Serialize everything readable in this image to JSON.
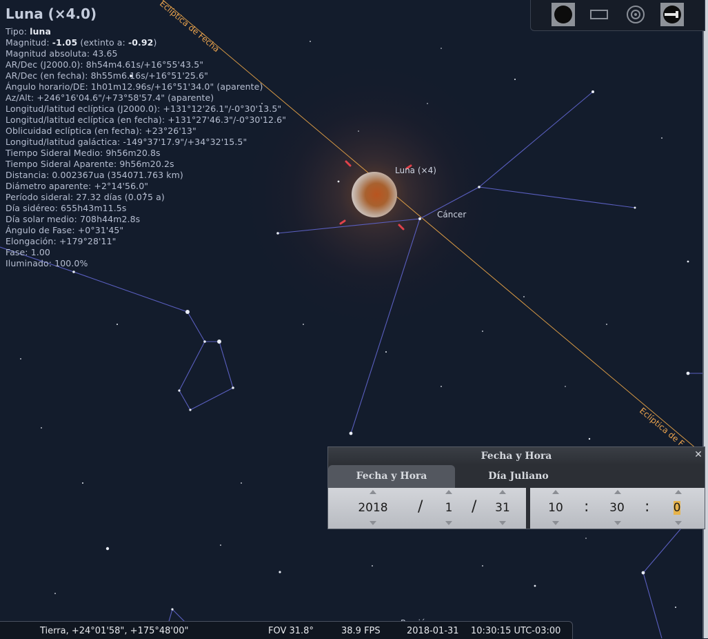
{
  "info": {
    "title": "Luna (×4.0)",
    "tipo_label": "Tipo: ",
    "tipo_value": "luna",
    "magnitud_label": "Magnitud: ",
    "magnitud_value": "-1.05",
    "magnitud_mid": " (extinto a: ",
    "magnitud_ext": "-0.92",
    "magnitud_end": ")",
    "rows": [
      "Magnitud absoluta: 43.65",
      "AR/Dec (J2000.0): 8h54m4.61s/+16°55'43.5\"",
      "AR/Dec (en fecha): 8h55m6.16s/+16°51'25.6\"",
      "Ángulo horario/DE: 1h01m12.96s/+16°51'34.0\" (aparente)",
      "Az/Alt: +246°16'04.6\"/+73°58'57.4\" (aparente)",
      "Longitud/latitud eclíptica (J2000.0): +131°12'26.1\"/-0°30'13.5\"",
      "Longitud/latitud eclíptica (en fecha): +131°27'46.3\"/-0°30'12.6\"",
      "Oblicuidad eclíptica (en fecha): +23°26'13\"",
      "Longitud/latitud galáctica: -149°37'17.9\"/+34°32'15.5\"",
      "Tiempo Sideral Medio: 9h56m20.8s",
      "Tiempo Sideral Aparente: 9h56m20.2s",
      "Distancia: 0.002367ua (354071.763 km)",
      "Diámetro aparente: +2°14'56.0\"",
      "Período sideral: 27.32 días (0.075 a)",
      "Día sidéreo: 655h43m11.5s",
      "Día solar medio: 708h44m2.8s",
      "Ángulo de Fase: +0°31'45\"",
      "Elongación: +179°28'11\"",
      "Fase: 1.00",
      "Iluminado: 100.0%"
    ]
  },
  "sky": {
    "moon_label": "Luna (×4)",
    "constellation_label": "Cáncer",
    "ecliptic_label_top": "Eclíptica de Fecha",
    "ecliptic_label_bottom": "Eclíptica de F",
    "star_label_bottom": "Proción"
  },
  "toolbar": {
    "icons": [
      "planet-icon",
      "rectangle-icon",
      "target-icon",
      "telescope-icon"
    ]
  },
  "dialog": {
    "title": "Fecha y Hora",
    "close": "✕",
    "tab_datetime": "Fecha y Hora",
    "tab_julian": "Día Juliano",
    "year": "2018",
    "month": "1",
    "day": "31",
    "hour": "10",
    "minute": "30",
    "second": "0",
    "date_sep": "/",
    "time_sep": ":"
  },
  "status": {
    "location": "Tierra, +24°01'58\", +175°48'00\"",
    "fov": "FOV 31.8°",
    "fps": "38.9 FPS",
    "date": "2018-01-31",
    "time": "10:30:15 UTC-03:00"
  },
  "colors": {
    "sky": "#131c2c",
    "constellation_line": "#5a5fc0",
    "ecliptic": "#e0a050",
    "info_text": "#b7bfd2"
  }
}
